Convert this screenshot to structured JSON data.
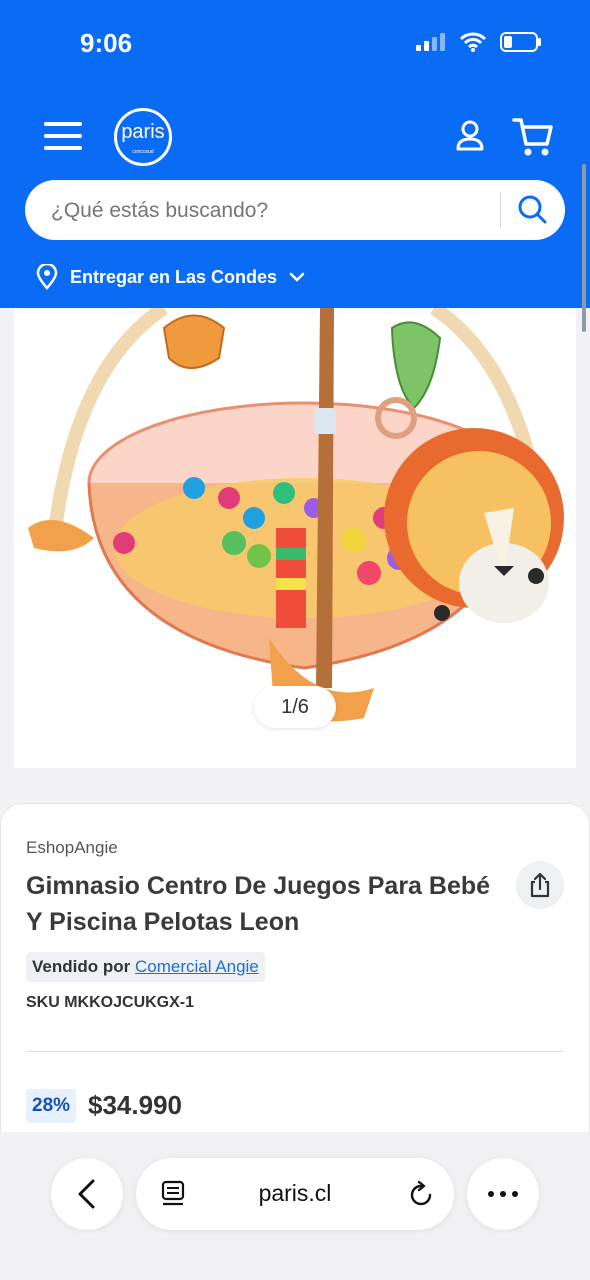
{
  "status": {
    "time": "9:06"
  },
  "header": {
    "logo_text": "paris",
    "logo_sub": "cencosud",
    "search_placeholder": "¿Qué estás buscando?",
    "delivery_text": "Entregar en Las Condes"
  },
  "gallery": {
    "counter": "1/6"
  },
  "product": {
    "brand": "EshopAngie",
    "title": "Gimnasio Centro De Juegos Para Bebé Y Piscina Pelotas Leon",
    "sold_by_label": "Vendido por",
    "seller": "Comercial Angie",
    "sku": "SKU MKKOJCUKGX-1",
    "discount": "28%",
    "price": "$34.990"
  },
  "browser": {
    "url": "paris.cl"
  },
  "colors": {
    "brand_blue": "#0a6cf5",
    "link": "#1a6fdc"
  }
}
